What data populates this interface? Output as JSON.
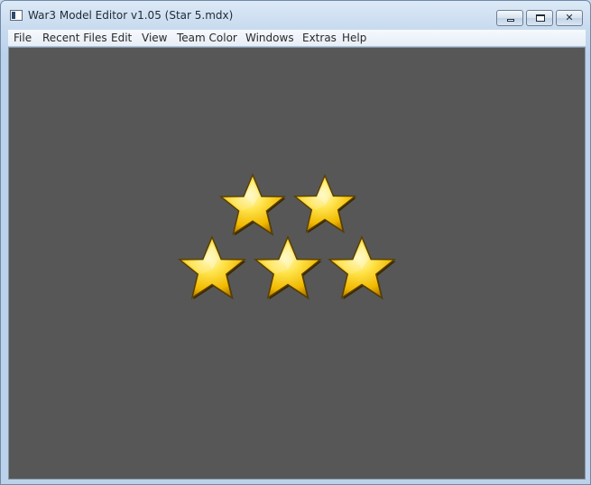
{
  "window": {
    "title": "War3 Model Editor v1.05 (Star 5.mdx)"
  },
  "controls": {
    "minimize_icon": "minimize-icon",
    "maximize_icon": "maximize-icon",
    "close_glyph": "✕"
  },
  "menu": [
    {
      "label": "File"
    },
    {
      "label": "Recent Files"
    },
    {
      "label": "Edit"
    },
    {
      "label": "View"
    },
    {
      "label": "Team Color"
    },
    {
      "label": "Windows"
    },
    {
      "label": "Extras"
    },
    {
      "label": "Help"
    }
  ],
  "viewport": {
    "background": "#575757",
    "star_count": 5,
    "star_color": "#f4c400"
  }
}
